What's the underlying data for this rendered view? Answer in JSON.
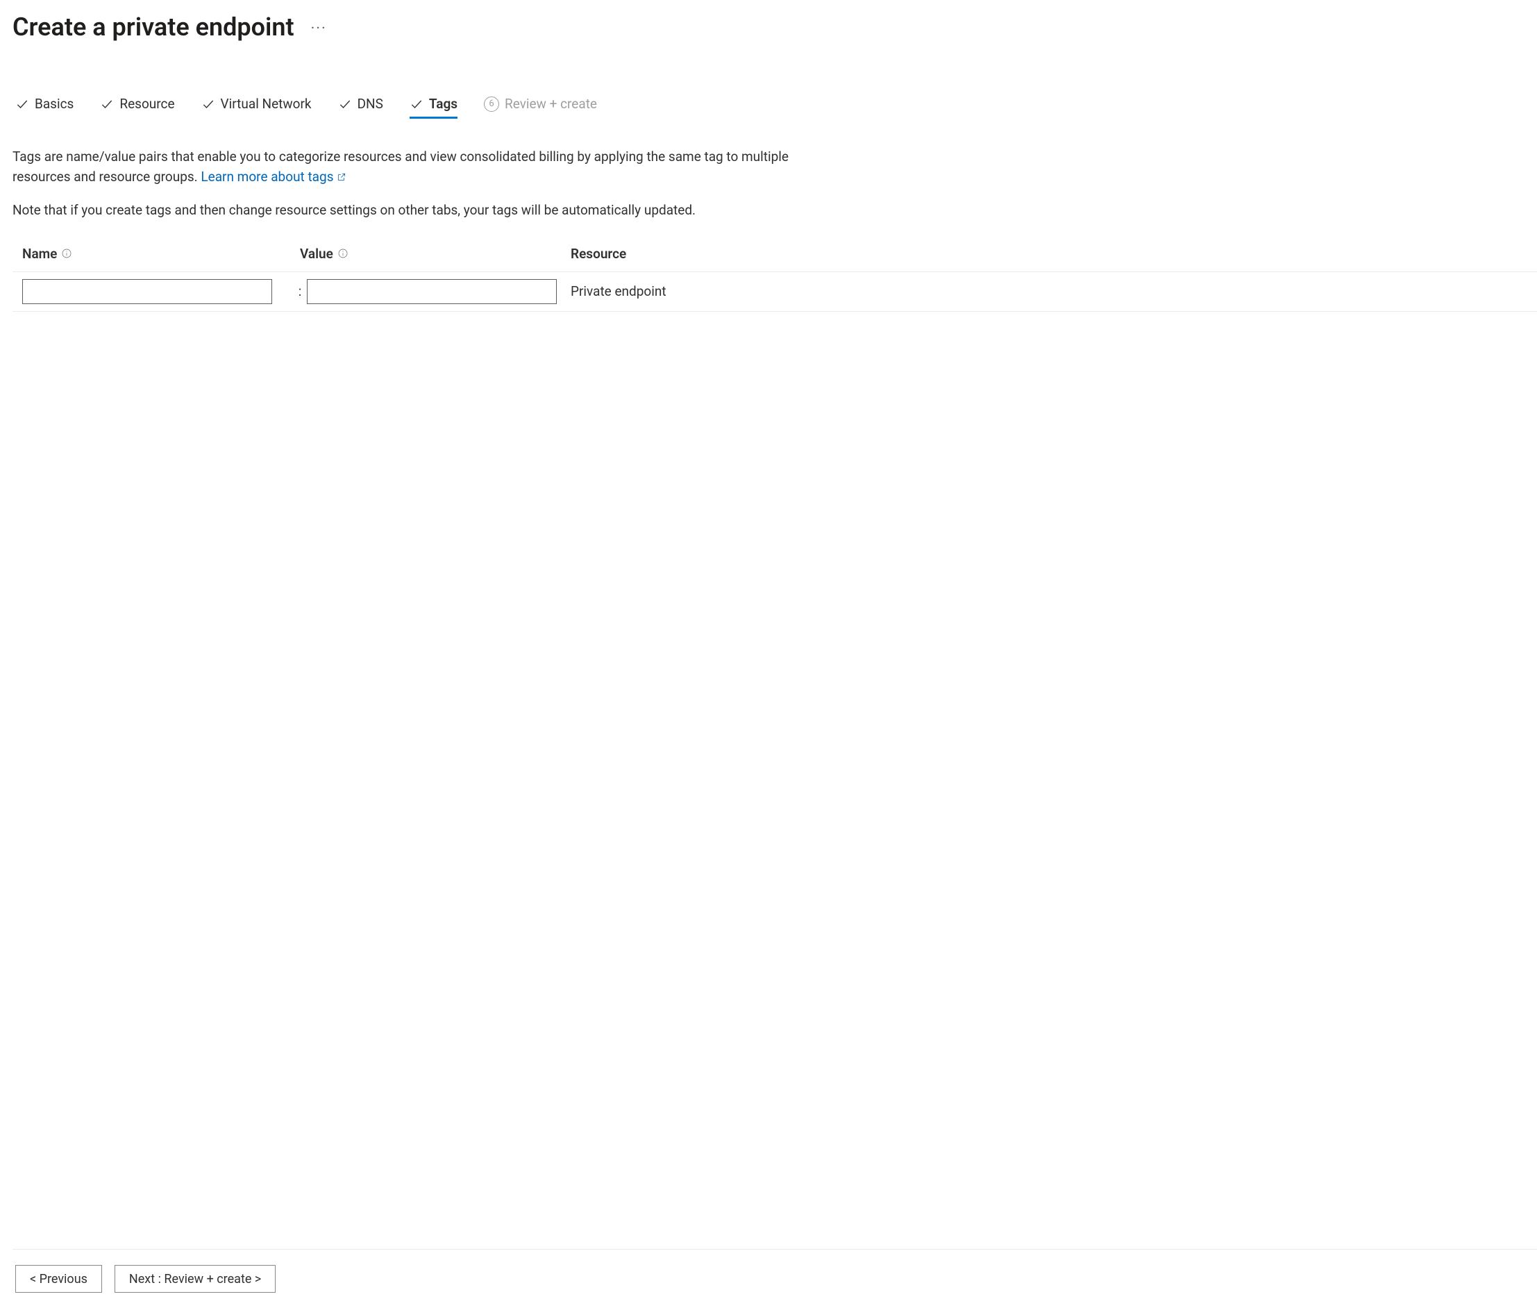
{
  "header": {
    "title": "Create a private endpoint"
  },
  "tabs": [
    {
      "label": "Basics",
      "state": "check"
    },
    {
      "label": "Resource",
      "state": "check"
    },
    {
      "label": "Virtual Network",
      "state": "check"
    },
    {
      "label": "DNS",
      "state": "check"
    },
    {
      "label": "Tags",
      "state": "check",
      "active": true
    },
    {
      "label": "Review + create",
      "state": "num",
      "num": "6",
      "disabled": true
    }
  ],
  "description": {
    "text": "Tags are name/value pairs that enable you to categorize resources and view consolidated billing by applying the same tag to multiple resources and resource groups. ",
    "link_label": "Learn more about tags"
  },
  "note": "Note that if you create tags and then change resource settings on other tabs, your tags will be automatically updated.",
  "columns": {
    "name": "Name",
    "value": "Value",
    "resource": "Resource"
  },
  "row": {
    "name_value": "",
    "value_value": "",
    "separator": ":",
    "resource": "Private endpoint"
  },
  "footer": {
    "previous": "< Previous",
    "next": "Next : Review + create >"
  }
}
